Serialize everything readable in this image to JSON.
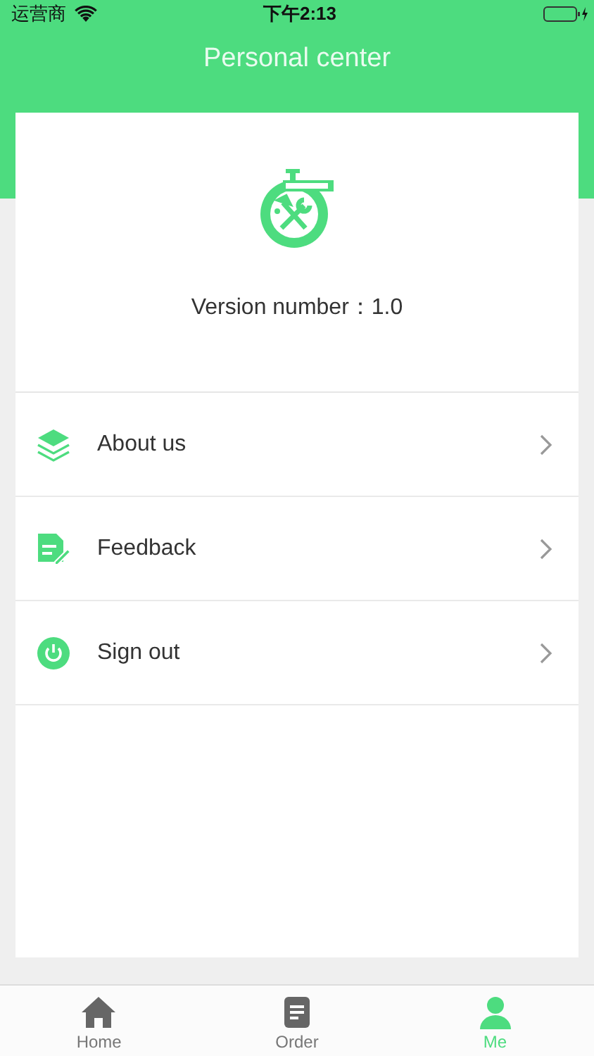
{
  "status_bar": {
    "carrier": "运营商",
    "time": "下午2:13"
  },
  "header": {
    "title": "Personal center"
  },
  "profile": {
    "version": "Version number：1.0"
  },
  "menu": [
    {
      "kind": "about",
      "label": "About us"
    },
    {
      "kind": "feedback",
      "label": "Feedback"
    },
    {
      "kind": "signout",
      "label": "Sign out"
    }
  ],
  "tabs": [
    {
      "kind": "home",
      "label": "Home",
      "selected": false
    },
    {
      "kind": "order",
      "label": "Order",
      "selected": false
    },
    {
      "kind": "me",
      "label": "Me",
      "selected": true
    }
  ]
}
